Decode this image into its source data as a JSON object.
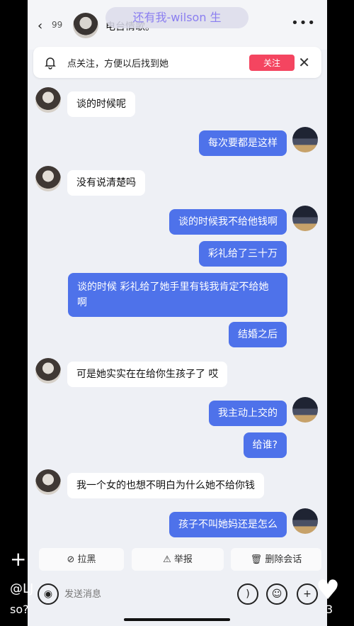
{
  "header": {
    "unread_count": "99",
    "title": "电台情歌。",
    "overlay_title": "还有我-wilson 生"
  },
  "notice": {
    "text": "点关注，方便以后找到她",
    "follow_label": "关注"
  },
  "messages": [
    {
      "side": "left",
      "text": "谈的时候呢"
    },
    {
      "side": "right",
      "text": "每次要都是这样"
    },
    {
      "side": "left",
      "text": "没有说清楚吗"
    },
    {
      "side": "right",
      "text": "谈的时候我不给他钱啊"
    },
    {
      "side": "right",
      "text": "彩礼给了三十万"
    },
    {
      "side": "right",
      "text": "谈的时候 彩礼给了她手里有钱我肯定不给她啊"
    },
    {
      "side": "right",
      "text": "结婚之后"
    },
    {
      "side": "left",
      "text": "可是她实实在在给你生孩子了 哎"
    },
    {
      "side": "right",
      "text": "我主动上交的"
    },
    {
      "side": "right",
      "text": "给谁?"
    },
    {
      "side": "left",
      "text": "我一个女的也想不明白为什么她不给你钱"
    },
    {
      "side": "right",
      "text": "孩子不叫她妈还是怎么"
    }
  ],
  "actions": {
    "block": "拉黑",
    "report": "举报",
    "delete": "删除会话"
  },
  "input": {
    "placeholder": "发送消息"
  },
  "overlay": {
    "plus": "+",
    "handle": "@LJ",
    "caption": "so?",
    "count": "3"
  },
  "colors": {
    "my_bubble": "#4e72ea",
    "follow_button": "#f44560"
  }
}
